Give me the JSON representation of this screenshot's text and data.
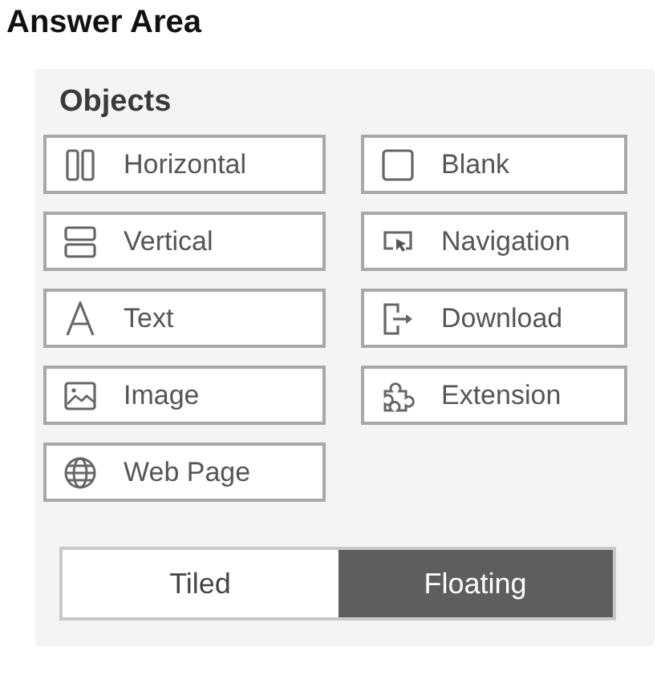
{
  "title": "Answer Area",
  "objects_panel": {
    "heading": "Objects",
    "items": [
      {
        "label": "Horizontal",
        "kind": "horizontal"
      },
      {
        "label": "Blank",
        "kind": "blank"
      },
      {
        "label": "Vertical",
        "kind": "vertical"
      },
      {
        "label": "Navigation",
        "kind": "navigation"
      },
      {
        "label": "Text",
        "kind": "text"
      },
      {
        "label": "Download",
        "kind": "download"
      },
      {
        "label": "Image",
        "kind": "image"
      },
      {
        "label": "Extension",
        "kind": "extension"
      },
      {
        "label": "Web Page",
        "kind": "webpage"
      }
    ],
    "mode_toggle": [
      {
        "label": "Tiled",
        "selected": false
      },
      {
        "label": "Floating",
        "selected": true
      }
    ]
  }
}
